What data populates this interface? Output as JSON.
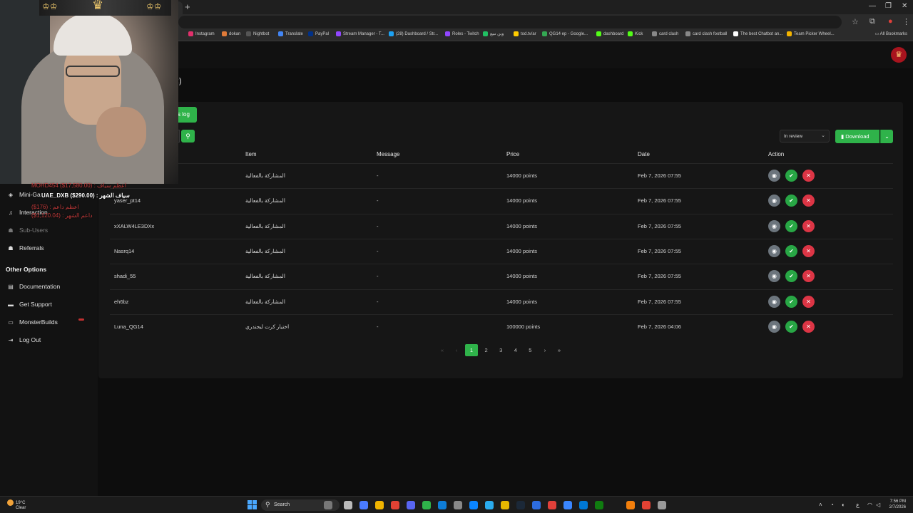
{
  "browser": {
    "bookmarks": [
      "Instagram",
      "dokan",
      "Nightbot",
      "Translate",
      "PayPal",
      "Stream Manager - T...",
      "(28) Dashboard / Str...",
      "Roles - Twitch",
      "وين نبيع",
      "tod.tv/ar",
      "QG14 ep - Google...",
      "dashboard",
      "Kick",
      "card clash",
      "card clash football",
      "The best Chatbot an...",
      "Team Picker Wheel..."
    ],
    "bookmarks_right": "All Bookmarks",
    "bookmark_colors": [
      "#e1306c",
      "#e07b39",
      "#555",
      "#4285f4",
      "#003087",
      "#9146ff",
      "#1da1f2",
      "#9146ff",
      "#21c063",
      "#ffcc00",
      "#34a853",
      "#53fc18",
      "#53fc18",
      "#888",
      "#888",
      "#fff",
      "#f4b400"
    ]
  },
  "header": {
    "page_title_fragment": ":)",
    "avatar_icon": "chicken-logo-icon"
  },
  "sidebar": {
    "items": [
      {
        "label": "Mini-Ga",
        "icon": "gamepad-icon",
        "disabled": false
      },
      {
        "label": "Interaction",
        "icon": "music-note-icon",
        "disabled": false
      },
      {
        "label": "Sub-Users",
        "icon": "users-icon",
        "disabled": true
      },
      {
        "label": "Referrals",
        "icon": "users-icon",
        "disabled": false
      }
    ],
    "other_heading": "Other Options",
    "other_items": [
      {
        "label": "Documentation",
        "icon": "book-icon"
      },
      {
        "label": "Get Support",
        "icon": "ticket-icon"
      },
      {
        "label": "MonsterBuilds",
        "icon": "laptop-icon"
      },
      {
        "label": "Log Out",
        "icon": "logout-icon"
      }
    ]
  },
  "toolbar": {
    "log_button": "s log",
    "status_select": "In review",
    "download_label": "Download"
  },
  "table": {
    "columns": [
      "Item",
      "Message",
      "Price",
      "Date",
      "Action"
    ],
    "rows": [
      {
        "user": "",
        "item": "المشاركة بالفعالية",
        "message": "-",
        "price": "14000 points",
        "date": "Feb 7, 2026 07:55"
      },
      {
        "user": "yaser_pt14",
        "item": "المشاركة بالفعالية",
        "message": "-",
        "price": "14000 points",
        "date": "Feb 7, 2026 07:55"
      },
      {
        "user": "xXALW4LE3DXx",
        "item": "المشاركة بالفعالية",
        "message": "-",
        "price": "14000 points",
        "date": "Feb 7, 2026 07:55"
      },
      {
        "user": "Nasrq14",
        "item": "المشاركة بالفعالية",
        "message": "-",
        "price": "14000 points",
        "date": "Feb 7, 2026 07:55"
      },
      {
        "user": "shadi_55",
        "item": "المشاركة بالفعالية",
        "message": "-",
        "price": "14000 points",
        "date": "Feb 7, 2026 07:55"
      },
      {
        "user": "eh6bz",
        "item": "المشاركة بالفعالية",
        "message": "-",
        "price": "14000 points",
        "date": "Feb 7, 2026 07:55"
      },
      {
        "user": "Luna_QG14",
        "item": "اختيار كرت ليجندري",
        "message": "-",
        "price": "100000 points",
        "date": "Feb 7, 2026 04:06"
      }
    ]
  },
  "pagination": {
    "first": "«",
    "prev": "‹",
    "pages": [
      "1",
      "2",
      "3",
      "4",
      "5"
    ],
    "active": "1",
    "next": "›",
    "last": "»"
  },
  "stream_overlay": {
    "supporters": [
      {
        "text": "MOHD454 ($17,580.00) : اعظم سياف",
        "style": "red"
      },
      {
        "text": "UAE_DXB ($290.00) : سياف الشهر",
        "style": "white"
      },
      {
        "text": "($176) : اعظم داعم",
        "style": "red"
      },
      {
        "text": "($1,120.04) : داعم الشهر",
        "style": "red"
      }
    ]
  },
  "taskbar": {
    "weather_temp": "19°C",
    "weather_desc": "Clear",
    "search": "Search",
    "time": "7:56 PM",
    "date": "2/7/2026",
    "lang": "ع"
  },
  "colors": {
    "accent": "#2fb34a",
    "view": "#6c757d",
    "approve": "#28a745",
    "reject": "#dc3545"
  }
}
